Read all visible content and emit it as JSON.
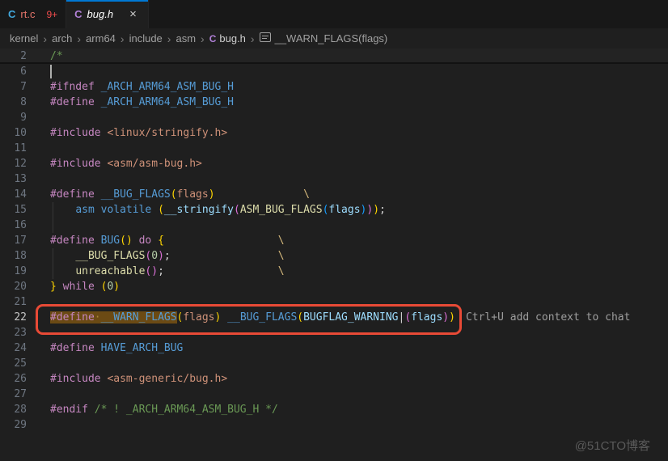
{
  "window": {
    "watermark": "@51CTO博客"
  },
  "colors": {
    "accent": "#0078d4",
    "annotation": "#E84A36",
    "selection": "#6b4a14",
    "kw": "#C586C0",
    "def": "#569CD6",
    "lb": "#9CDCFE",
    "param": "#CE9178",
    "str": "#CE9178",
    "com": "#6A9955",
    "fn": "#DCDCAA",
    "num": "#B5CEA8",
    "b1": "#FFD602",
    "b2": "#DA70D6",
    "b3": "#179FFF",
    "pl": "#D4D4D4",
    "esc": "#D7BA7D",
    "ws": "#a8853a",
    "c_icon_blue": "#42a8dd",
    "c_icon_purple": "#b180d7",
    "error_text": "#e4756a",
    "badge_text": "#f14c4c"
  },
  "tabs": [
    {
      "label": "rt.c",
      "icon": "C",
      "icon_color": "c_icon_blue",
      "label_color": "#e4756a",
      "badge": "9+",
      "active": false,
      "italic": false,
      "close": null
    },
    {
      "label": "bug.h",
      "icon": "C",
      "icon_color": "c_icon_purple",
      "label_color": "#ffffff",
      "badge": null,
      "active": true,
      "italic": true,
      "close": "×"
    }
  ],
  "breadcrumbs": {
    "separator": "›",
    "items": [
      {
        "label": "kernel"
      },
      {
        "label": "arch"
      },
      {
        "label": "arm64"
      },
      {
        "label": "include"
      },
      {
        "label": "asm"
      },
      {
        "label": "bug.h",
        "icon": "C",
        "file": true
      },
      {
        "label": "__WARN_FLAGS(flags)",
        "symbol": true
      }
    ]
  },
  "editor": {
    "hint": "Ctrl+U add context to chat",
    "lines": [
      {
        "n": "2",
        "cls": "fold",
        "seg": [
          [
            "/*",
            "com"
          ]
        ]
      },
      {
        "n": "6",
        "cls": "cursor-line",
        "seg": []
      },
      {
        "n": "7",
        "seg": [
          [
            "#ifndef ",
            "kw"
          ],
          [
            "_ARCH_ARM64_ASM_BUG_H",
            "def"
          ]
        ]
      },
      {
        "n": "8",
        "seg": [
          [
            "#define ",
            "kw"
          ],
          [
            "_ARCH_ARM64_ASM_BUG_H",
            "def"
          ]
        ]
      },
      {
        "n": "9",
        "seg": []
      },
      {
        "n": "10",
        "seg": [
          [
            "#include ",
            "kw"
          ],
          [
            "<linux/stringify.h>",
            "str"
          ]
        ]
      },
      {
        "n": "11",
        "seg": []
      },
      {
        "n": "12",
        "seg": [
          [
            "#include ",
            "kw"
          ],
          [
            "<asm/asm-bug.h>",
            "str"
          ]
        ]
      },
      {
        "n": "13",
        "seg": []
      },
      {
        "n": "14",
        "seg": [
          [
            "#define ",
            "kw"
          ],
          [
            "__BUG_FLAGS",
            "def"
          ],
          [
            "(",
            "b1"
          ],
          [
            "flags",
            "param"
          ],
          [
            ")",
            "b1"
          ],
          [
            "              ",
            "pl"
          ],
          [
            "\\",
            "esc"
          ]
        ]
      },
      {
        "n": "15",
        "cls": "guide",
        "seg": [
          [
            "    ",
            "pl"
          ],
          [
            "asm",
            "def"
          ],
          [
            " ",
            "pl"
          ],
          [
            "volatile",
            "def"
          ],
          [
            " ",
            "pl"
          ],
          [
            "(",
            "b1"
          ],
          [
            "__stringify",
            "lb"
          ],
          [
            "(",
            "b2"
          ],
          [
            "ASM_BUG_FLAGS",
            "fn"
          ],
          [
            "(",
            "b3"
          ],
          [
            "flags",
            "lb"
          ],
          [
            ")",
            "b3"
          ],
          [
            ")",
            "b2"
          ],
          [
            ")",
            "b1"
          ],
          [
            ";",
            "pl"
          ]
        ]
      },
      {
        "n": "16",
        "cls": "guide",
        "seg": []
      },
      {
        "n": "17",
        "seg": [
          [
            "#define ",
            "kw"
          ],
          [
            "BUG",
            "def"
          ],
          [
            "(",
            "b1"
          ],
          [
            ")",
            "b1"
          ],
          [
            " ",
            "pl"
          ],
          [
            "do",
            "kw"
          ],
          [
            " ",
            "pl"
          ],
          [
            "{",
            "b1"
          ],
          [
            "                  ",
            "pl"
          ],
          [
            "\\",
            "esc"
          ]
        ]
      },
      {
        "n": "18",
        "cls": "guide",
        "seg": [
          [
            "    ",
            "pl"
          ],
          [
            "__BUG_FLAGS",
            "fn"
          ],
          [
            "(",
            "b2"
          ],
          [
            "0",
            "num"
          ],
          [
            ")",
            "b2"
          ],
          [
            ";",
            "pl"
          ],
          [
            "                 ",
            "pl"
          ],
          [
            "\\",
            "esc"
          ]
        ]
      },
      {
        "n": "19",
        "cls": "guide",
        "seg": [
          [
            "    ",
            "pl"
          ],
          [
            "unreachable",
            "fn"
          ],
          [
            "(",
            "b2"
          ],
          [
            ")",
            "b2"
          ],
          [
            ";",
            "pl"
          ],
          [
            "                  ",
            "pl"
          ],
          [
            "\\",
            "esc"
          ]
        ]
      },
      {
        "n": "20",
        "seg": [
          [
            "}",
            "b1"
          ],
          [
            " ",
            "pl"
          ],
          [
            "while",
            "kw"
          ],
          [
            " ",
            "pl"
          ],
          [
            "(",
            "b1"
          ],
          [
            "0",
            "num"
          ],
          [
            ")",
            "b1"
          ]
        ]
      },
      {
        "n": "21",
        "seg": []
      },
      {
        "n": "22",
        "active": true,
        "annotated": true,
        "hint": true,
        "seg": [
          [
            "#define",
            "kw",
            "hl"
          ],
          [
            "·",
            "ws",
            "hl"
          ],
          [
            "__WARN_FLAGS",
            "def",
            "hl"
          ],
          [
            "(",
            "b1"
          ],
          [
            "flags",
            "param"
          ],
          [
            ")",
            "b1"
          ],
          [
            " ",
            "pl"
          ],
          [
            "__BUG_FLAGS",
            "def"
          ],
          [
            "(",
            "b1"
          ],
          [
            "BUGFLAG_WARNING",
            "lb"
          ],
          [
            "|",
            "pl"
          ],
          [
            "(",
            "b2"
          ],
          [
            "flags",
            "lb"
          ],
          [
            ")",
            "b2"
          ],
          [
            ")",
            "b1"
          ]
        ]
      },
      {
        "n": "23",
        "seg": []
      },
      {
        "n": "24",
        "seg": [
          [
            "#define ",
            "kw"
          ],
          [
            "HAVE_ARCH_BUG",
            "def"
          ]
        ]
      },
      {
        "n": "25",
        "seg": []
      },
      {
        "n": "26",
        "seg": [
          [
            "#include ",
            "kw"
          ],
          [
            "<asm-generic/bug.h>",
            "str"
          ]
        ]
      },
      {
        "n": "27",
        "seg": []
      },
      {
        "n": "28",
        "seg": [
          [
            "#endif ",
            "kw"
          ],
          [
            "/* ! _ARCH_ARM64_ASM_BUG_H */",
            "com"
          ]
        ]
      },
      {
        "n": "29",
        "seg": []
      }
    ]
  }
}
